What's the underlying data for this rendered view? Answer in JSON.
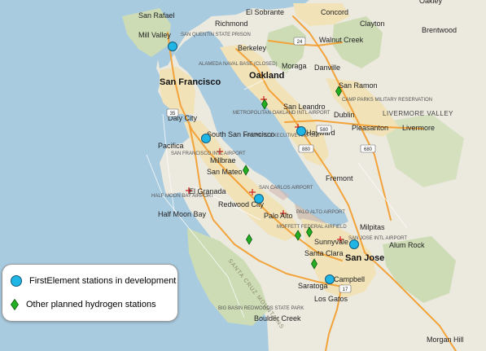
{
  "colors": {
    "water": "#a9cbe0",
    "land": "#ece9df",
    "park": "#cddcb5",
    "urban": "#f1e2b8",
    "freeway": "#f2a33a",
    "firstelement": "#1fb6e6",
    "hydrogen": "#22b022"
  },
  "legend": {
    "firstelement_label": "FirstElement stations in development",
    "hydrogen_label": "Other planned hydrogen stations",
    "firstelement_icon": "circle-marker",
    "hydrogen_icon": "diamond-marker"
  },
  "places": [
    {
      "name": "San Rafael",
      "cls": "city"
    },
    {
      "name": "El Sobrante",
      "cls": "city"
    },
    {
      "name": "Concord",
      "cls": "city"
    },
    {
      "name": "Oakley",
      "cls": "city"
    },
    {
      "name": "Richmond",
      "cls": "city"
    },
    {
      "name": "Mill Valley",
      "cls": "city"
    },
    {
      "name": "Walnut Creek",
      "cls": "city"
    },
    {
      "name": "Clayton",
      "cls": "city"
    },
    {
      "name": "Brentwood",
      "cls": "city"
    },
    {
      "name": "Berkeley",
      "cls": "city"
    },
    {
      "name": "Oakland",
      "cls": "big"
    },
    {
      "name": "Moraga",
      "cls": "city"
    },
    {
      "name": "Danville",
      "cls": "city"
    },
    {
      "name": "San Francisco",
      "cls": "big"
    },
    {
      "name": "San Ramon",
      "cls": "city"
    },
    {
      "name": "San Leandro",
      "cls": "city"
    },
    {
      "name": "Dublin",
      "cls": "city"
    },
    {
      "name": "Pleasanton",
      "cls": "city"
    },
    {
      "name": "Livermore",
      "cls": "city"
    },
    {
      "name": "Daly City",
      "cls": "city"
    },
    {
      "name": "Hayward",
      "cls": "city"
    },
    {
      "name": "South San Francisco",
      "cls": "city"
    },
    {
      "name": "Pacifica",
      "cls": "city"
    },
    {
      "name": "Millbrae",
      "cls": "city"
    },
    {
      "name": "San Mateo",
      "cls": "city"
    },
    {
      "name": "Fremont",
      "cls": "city"
    },
    {
      "name": "El Granada",
      "cls": "city"
    },
    {
      "name": "Redwood City",
      "cls": "city"
    },
    {
      "name": "Half Moon Bay",
      "cls": "city"
    },
    {
      "name": "Palo Alto",
      "cls": "city"
    },
    {
      "name": "Milpitas",
      "cls": "city"
    },
    {
      "name": "Sunnyvale",
      "cls": "city"
    },
    {
      "name": "Alum Rock",
      "cls": "city"
    },
    {
      "name": "Santa Clara",
      "cls": "city"
    },
    {
      "name": "San Jose",
      "cls": "big"
    },
    {
      "name": "Campbell",
      "cls": "city"
    },
    {
      "name": "Saratoga",
      "cls": "city"
    },
    {
      "name": "Los Gatos",
      "cls": "city"
    },
    {
      "name": "Boulder Creek",
      "cls": "city"
    },
    {
      "name": "Morgan Hill",
      "cls": "city"
    },
    {
      "name": "LIVERMORE VALLEY",
      "cls": "valley"
    }
  ],
  "features": [
    {
      "name": "SAN QUENTIN STATE PRISON"
    },
    {
      "name": "ALAMEDA NAVAL BASE (CLOSED)"
    },
    {
      "name": "METROPOLITAN OAKLAND INTL AIRPORT"
    },
    {
      "name": "HAYWARD EXECUTIVE AIRPORT"
    },
    {
      "name": "CAMP PARKS MILITARY RESERVATION"
    },
    {
      "name": "SAN FRANCISCO INTL AIRPORT"
    },
    {
      "name": "SAN CARLOS AIRPORT"
    },
    {
      "name": "HALF MOON BAY AIRPORT"
    },
    {
      "name": "PALO ALTO AIRPORT"
    },
    {
      "name": "MOFFETT FEDERAL AIRFIELD"
    },
    {
      "name": "SAN JOSE INTL AIRPORT"
    },
    {
      "name": "SANTA CRUZ MOUNTAINS"
    },
    {
      "name": "BIG BASIN REDWOODS STATE PARK"
    }
  ],
  "highways": [
    "24",
    "580",
    "35",
    "680",
    "880",
    "17"
  ],
  "firstelement_stations": [
    {
      "name": "Mill Valley"
    },
    {
      "name": "South San Francisco"
    },
    {
      "name": "Hayward"
    },
    {
      "name": "Redwood City"
    },
    {
      "name": "San Jose"
    },
    {
      "name": "Campbell"
    }
  ],
  "hydrogen_stations": [
    {
      "name": "San Ramon"
    },
    {
      "name": "Oakland"
    },
    {
      "name": "San Mateo"
    },
    {
      "name": "Woodside"
    },
    {
      "name": "Mountain View"
    },
    {
      "name": "Sunnyvale"
    },
    {
      "name": "Saratoga"
    }
  ]
}
